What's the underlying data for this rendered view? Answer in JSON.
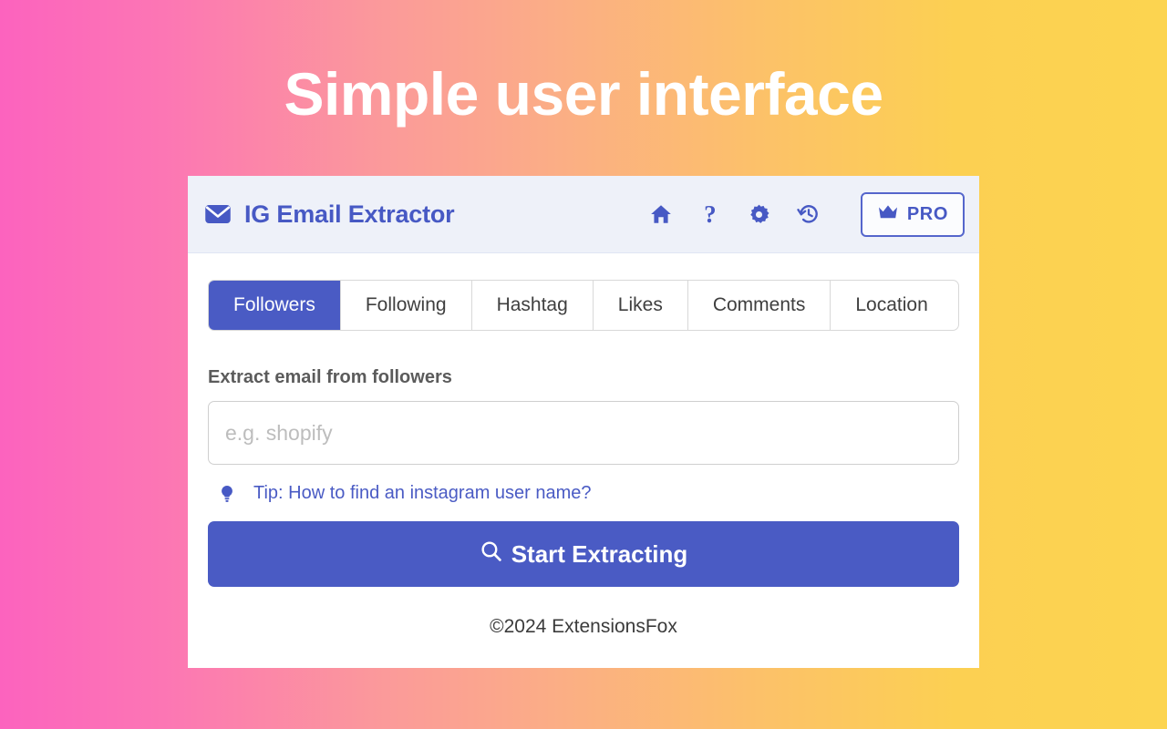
{
  "headline": "Simple user interface",
  "card": {
    "header": {
      "brand_icon": "envelope-icon",
      "brand_title": "IG Email Extractor",
      "actions": [
        {
          "name": "home-icon",
          "label": ""
        },
        {
          "name": "help-icon",
          "label": "?"
        },
        {
          "name": "gear-icon",
          "label": ""
        },
        {
          "name": "history-icon",
          "label": ""
        }
      ],
      "pro_button": {
        "icon": "crown-icon",
        "label": "PRO"
      }
    },
    "tabs": [
      {
        "label": "Followers",
        "active": true
      },
      {
        "label": "Following",
        "active": false
      },
      {
        "label": "Hashtag",
        "active": false
      },
      {
        "label": "Likes",
        "active": false
      },
      {
        "label": "Comments",
        "active": false
      },
      {
        "label": "Location",
        "active": false
      }
    ],
    "form": {
      "field_label": "Extract email from followers",
      "input_value": "",
      "input_placeholder": "e.g. shopify",
      "tip_icon": "lightbulb-icon",
      "tip_text": "Tip: How to find an instagram user name?",
      "submit_icon": "search-icon",
      "submit_label": "Start Extracting"
    },
    "footer": "©2024 ExtensionsFox"
  },
  "colors": {
    "brand_blue": "#4759c4",
    "accent_blue": "#4a5bc4",
    "header_bg": "#eef1f9",
    "gradient_start": "#fc63be",
    "gradient_end": "#fcd450"
  }
}
